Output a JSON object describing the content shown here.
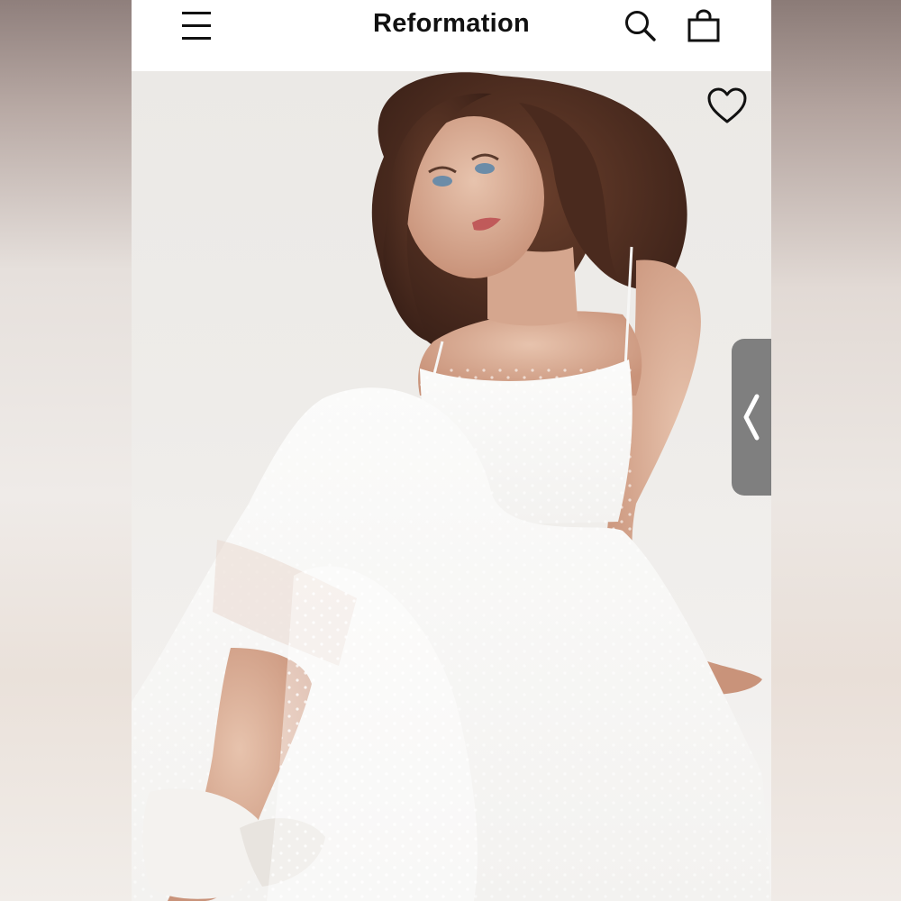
{
  "header": {
    "brand": "Reformation",
    "icons": {
      "menu": "hamburger-menu-icon",
      "search": "search-icon",
      "bag": "shopping-bag-icon"
    }
  },
  "hero": {
    "favorite_icon": "heart-outline-icon",
    "gallery_handle_icon": "chevron-left-icon"
  },
  "colors": {
    "header_bg": "#ffffff",
    "brand_text": "#111111",
    "handle_bg": "#7f7f7f",
    "photo_bg": "#ecebe8"
  }
}
